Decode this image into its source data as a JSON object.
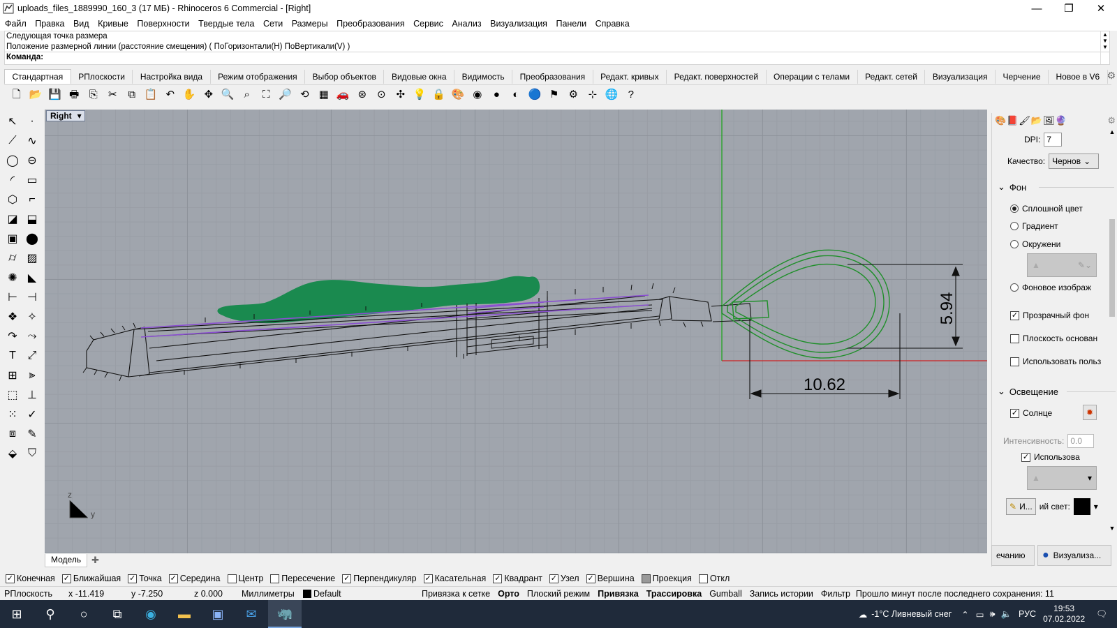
{
  "window": {
    "title": "uploads_files_1889990_160_3 (17 МБ) - Rhinoceros 6 Commercial - [Right]",
    "controls": [
      "—",
      "❐",
      "✕"
    ]
  },
  "menu": [
    "Файл",
    "Правка",
    "Вид",
    "Кривые",
    "Поверхности",
    "Твердые тела",
    "Сети",
    "Размеры",
    "Преобразования",
    "Сервис",
    "Анализ",
    "Визуализация",
    "Панели",
    "Справка"
  ],
  "command": {
    "history1": "Следующая точка размера",
    "history2": "Положение размерной линии (расстояние смещения) ( ПоГоризонтали(H)  ПоВертикали(V) )",
    "prompt": "Команда:"
  },
  "toolbar_tabs": [
    "Стандартная",
    "РПлоскости",
    "Настройка вида",
    "Режим отображения",
    "Выбор объектов",
    "Видовые окна",
    "Видимость",
    "Преобразования",
    "Редакт. кривых",
    "Редакт. поверхностей",
    "Операции с телами",
    "Редакт. сетей",
    "Визуализация",
    "Черчение",
    "Новое в V6"
  ],
  "toolbar_icons": [
    "new-file-icon",
    "open-file-icon",
    "save-icon",
    "print-icon",
    "import-icon",
    "cut-icon",
    "copy-icon",
    "paste-icon",
    "undo-icon",
    "pan-hand-icon",
    "rotate-view-icon",
    "zoom-icon",
    "zoom-window-icon",
    "zoom-extents-icon",
    "zoom-selected-icon",
    "undo-view-icon",
    "four-viewports-icon",
    "car-icon",
    "render-preview-icon",
    "circle-point-icon",
    "grid-snap-icon",
    "light-bulb-icon",
    "lock-icon",
    "material-icon",
    "color-wheel-icon",
    "shaded-sphere-icon",
    "rendered-sphere-icon",
    "blue-sphere-icon",
    "filter-icon",
    "settings-gear-icon",
    "dimensions-icon",
    "globe-icon",
    "help-icon"
  ],
  "toolbar_glyphs": [
    "🗋",
    "📂",
    "💾",
    "🖶",
    "⎘",
    "✂",
    "⧉",
    "📋",
    "↶",
    "✋",
    "✥",
    "🔍",
    "⌕",
    "⛶",
    "🔎",
    "⟲",
    "▦",
    "🚗",
    "⊛",
    "⊙",
    "✣",
    "💡",
    "🔒",
    "🎨",
    "◉",
    "●",
    "◐",
    "🔵",
    "⚑",
    "⚙",
    "⊹",
    "🌐",
    "?"
  ],
  "viewport": {
    "name": "Right",
    "axis_z": "z",
    "axis_y": "y",
    "dim_vertical": "5.94",
    "dim_horizontal": "10.62"
  },
  "model_tab": "Модель",
  "right_panel": {
    "dpi_label": "DPI:",
    "dpi_value": "7",
    "quality_label": "Качество:",
    "quality_value": "Чернов",
    "section_background": "Фон",
    "bg_solid": "Сплошной цвет",
    "bg_gradient": "Градиент",
    "bg_environment": "Окружени",
    "bg_image": "Фоновое изображ",
    "transparent_bg": "Прозрачный фон",
    "ground_plane": "Плоскость основан",
    "use_custom": "Использовать польз",
    "section_lighting": "Освещение",
    "sun": "Солнце",
    "intensity_label": "Интенсивность:",
    "intensity_value": "0.0",
    "use_label": "Использова",
    "ambient_button": "И...",
    "ambient_label": "ий свет:",
    "tab_default": "ечанию",
    "tab_render": "Визуализа..."
  },
  "osnaps": [
    {
      "label": "Конечная",
      "checked": true
    },
    {
      "label": "Ближайшая",
      "checked": true
    },
    {
      "label": "Точка",
      "checked": true
    },
    {
      "label": "Середина",
      "checked": true
    },
    {
      "label": "Центр",
      "checked": false
    },
    {
      "label": "Пересечение",
      "checked": false
    },
    {
      "label": "Перпендикуляр",
      "checked": true
    },
    {
      "label": "Касательная",
      "checked": true
    },
    {
      "label": "Квадрант",
      "checked": true
    },
    {
      "label": "Узел",
      "checked": true
    },
    {
      "label": "Вершина",
      "checked": true
    },
    {
      "label": "Проекция",
      "checked": false
    },
    {
      "label": "Откл",
      "checked": false
    }
  ],
  "status": {
    "cplane": "РПлоскость",
    "x": "x -11.419",
    "y": "y -7.250",
    "z": "z 0.000",
    "units": "Миллиметры",
    "layer": "Default",
    "grid_snap": "Привязка к сетке",
    "ortho": "Орто",
    "planar": "Плоский режим",
    "osnap": "Привязка",
    "smarttrack": "Трассировка",
    "gumball": "Gumball",
    "history": "Запись истории",
    "filter": "Фильтр",
    "saved": "Прошло минут после последнего сохранения: 11"
  },
  "taskbar": {
    "weather": "-1°C  Ливневый снег",
    "lang": "РУС",
    "time": "19:53",
    "date": "07.02.2022"
  },
  "colors": {
    "viewport_bg": "#a0a5ad",
    "green_model": "#1a8a4f",
    "purple_curve": "#8a4fd0"
  }
}
